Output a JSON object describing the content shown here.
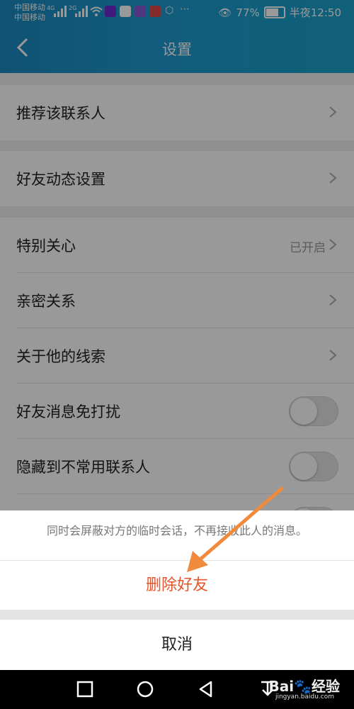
{
  "status_bar": {
    "carrier1": "中国移动",
    "carrier2": "中国移动",
    "net1": "4G",
    "net2": "2G",
    "battery": "77%",
    "time_label": "半夜12:50"
  },
  "header": {
    "title": "设置",
    "back_icon": "chevron-left-icon"
  },
  "settings": {
    "recommend": "推荐该联系人",
    "friend_dynamics": "好友动态设置",
    "special_care": "特别关心",
    "special_care_value": "已开启",
    "intimacy": "亲密关系",
    "clues": "关于他的线索",
    "do_not_disturb": "好友消息免打扰",
    "do_not_disturb_on": false,
    "hide_infrequent": "隐藏到不常用联系人",
    "hide_infrequent_on": false
  },
  "action_sheet": {
    "message": "同时会屏蔽对方的临时会话，不再接收此人的消息。",
    "delete_label": "删除好友",
    "cancel_label": "取消"
  },
  "colors": {
    "header": "#1e9bd0",
    "delete": "#e4552c",
    "arrow": "#f08a3c"
  },
  "watermark": {
    "brand": "Bai",
    "brand_cn": "经验",
    "url": "jingyan.baidu.com"
  }
}
